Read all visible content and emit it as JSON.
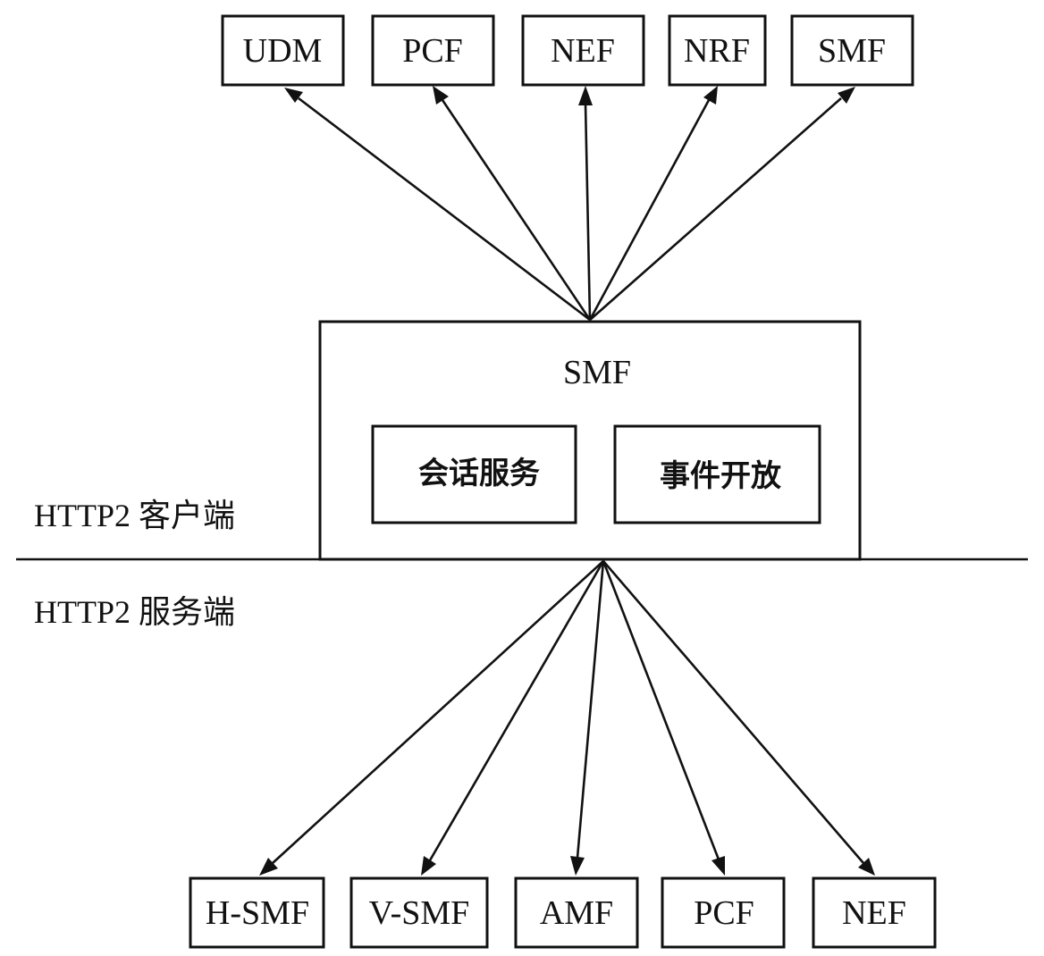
{
  "client_targets": [
    "UDM",
    "PCF",
    "NEF",
    "NRF",
    "SMF"
  ],
  "server_sources": [
    "H-SMF",
    "V-SMF",
    "AMF",
    "PCF",
    "NEF"
  ],
  "smf": {
    "title": "SMF",
    "modules": [
      "会话服务",
      "事件开放"
    ]
  },
  "labels": {
    "client": "HTTP2 客户端",
    "server": "HTTP2 服务端"
  },
  "colors": {
    "line": "#111111",
    "background": "#ffffff"
  }
}
